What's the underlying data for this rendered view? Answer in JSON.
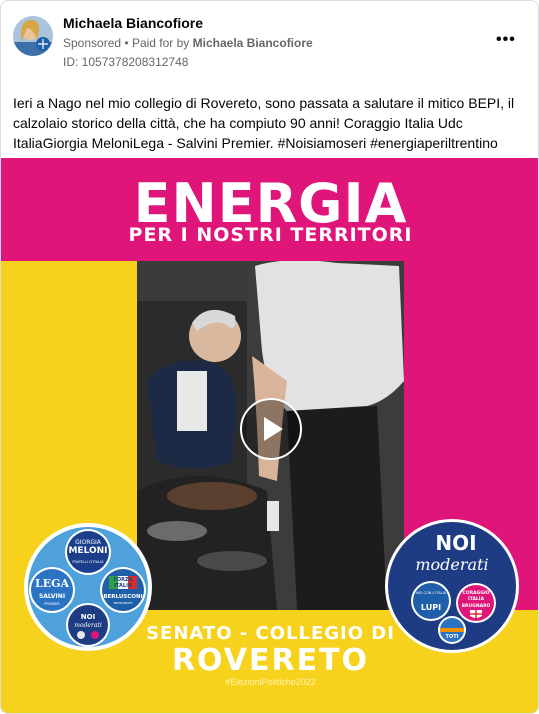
{
  "post": {
    "author": "Michaela Biancofiore",
    "sponsored_label": "Sponsored",
    "paid_for_prefix": "Paid for by",
    "paid_for_name": "Michaela Biancofiore",
    "ad_id": "ID: 1057378208312748",
    "more_label": "•••",
    "body_line1": "Ieri a Nago nel mio collegio di Rovereto, sono passata a salutare il mitico BEPI, il",
    "body_line2": "calzolaio storico della città, che ha compiuto 90 anni! Coraggio Italia Udc",
    "body_line3": "ItaliaGiorgia MeloniLega - Salvini Premier. #Noisiamoseri #energiaperiltrentino"
  },
  "creative": {
    "headline": "ENERGIA",
    "subheadline": "PER I NOSTRI TERRITORI",
    "tagline1": "SENATO - COLLEGIO DI",
    "tagline2": "ROVERETO",
    "hashtag": "#ElezioniPolitiche2022",
    "left_logo": {
      "top": "GIORGIA",
      "meloni": "MELONI",
      "fdi": "FRATELLI D'ITALIA",
      "lega": "LEGA",
      "salvini": "SALVINI",
      "premier": "PREMIER",
      "forza1": "FORZA",
      "forza2": "ITALIA",
      "berlusconi": "BERLUSCONI",
      "presidente": "PRESIDENTE",
      "ppe": "PARTITO POPOLARE EUROPEO",
      "noi": "NOI",
      "moderati": "moderati"
    },
    "right_logo": {
      "noi": "NOI",
      "moderati": "moderati",
      "noi_italia": "NOI CON L'ITALIA",
      "lupi": "LUPI",
      "coraggio1": "CORAGGIO",
      "coraggio2": "ITALIA",
      "brugnaro": "BRUGNARO",
      "toti": "TOTI"
    }
  },
  "colors": {
    "magenta": "#e0157a",
    "yellow": "#f7d21c",
    "text_dark": "#050505",
    "text_muted": "#65676b"
  },
  "icons": {
    "avatar": "avatar-photo",
    "more": "more-dots-icon",
    "play": "play-icon"
  }
}
